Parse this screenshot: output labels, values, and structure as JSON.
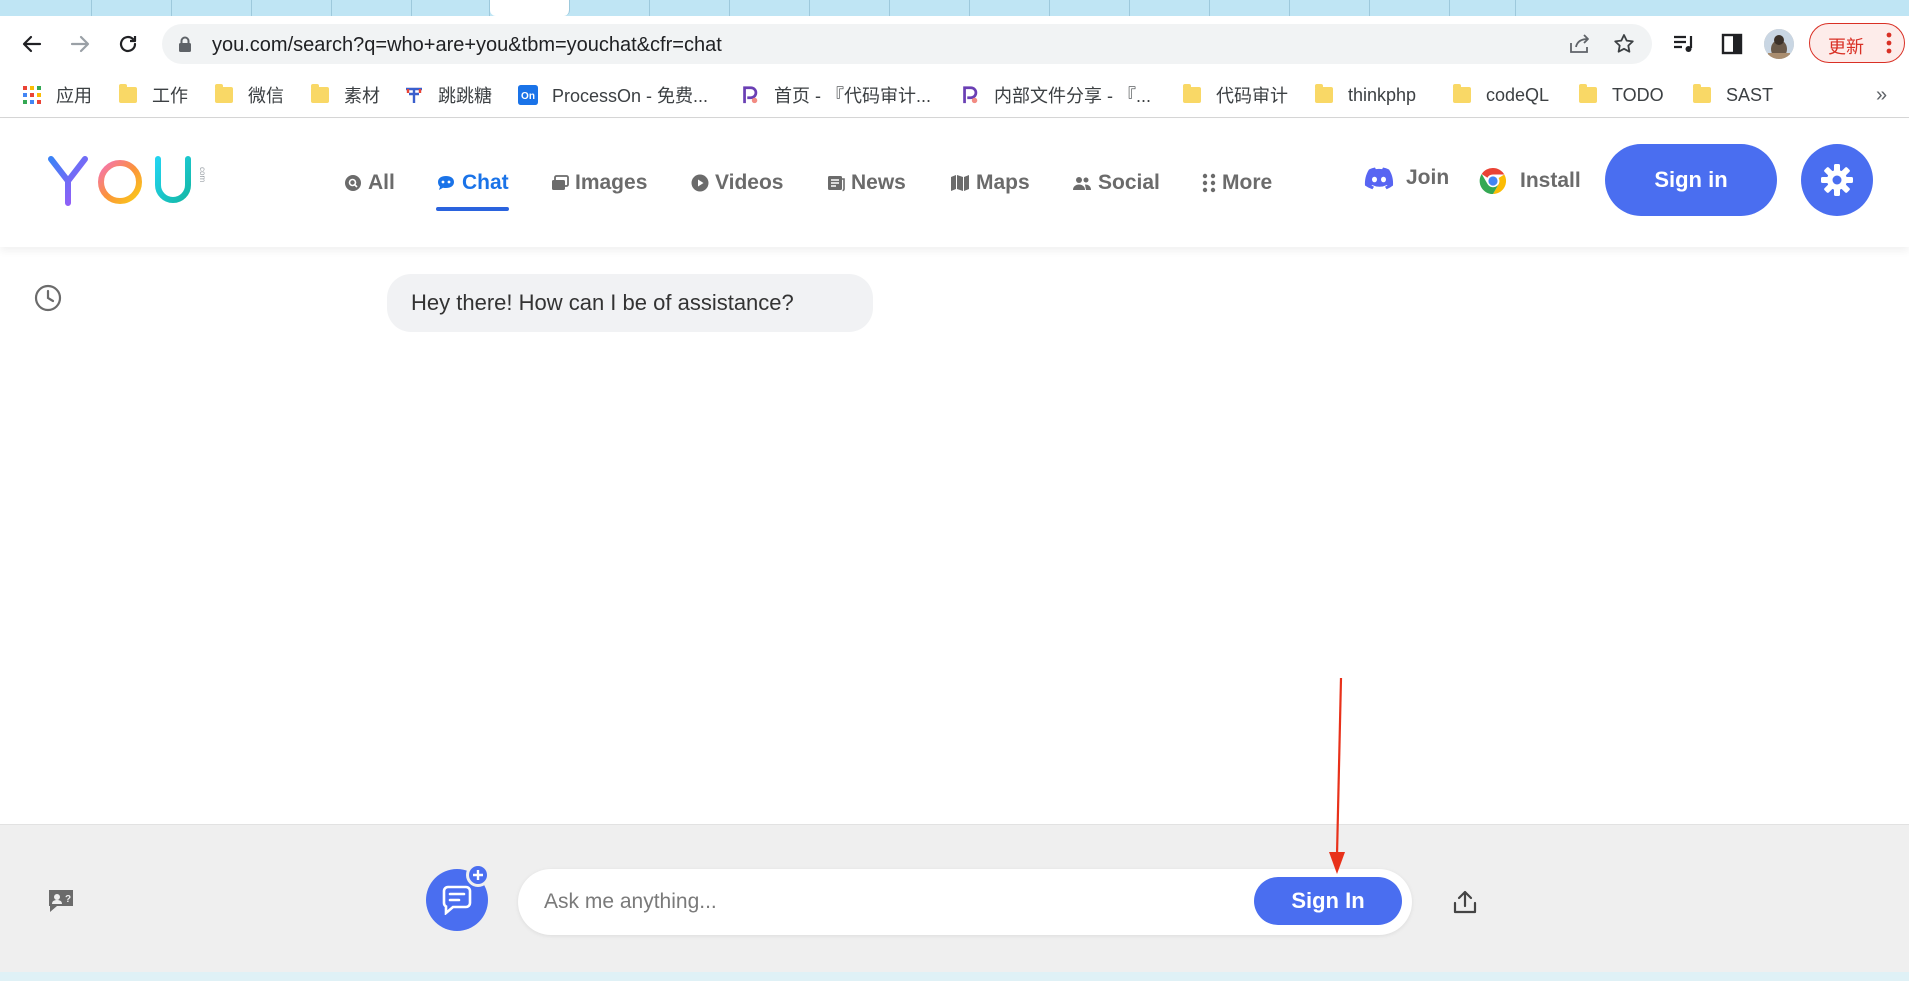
{
  "browser": {
    "url": "you.com/search?q=who+are+you&tbm=youchat&cfr=chat",
    "update_label": "更新",
    "bookmarks": [
      {
        "label": "应用",
        "icon": "apps-grid-icon"
      },
      {
        "label": "工作",
        "icon": "folder-icon"
      },
      {
        "label": "微信",
        "icon": "folder-icon"
      },
      {
        "label": "素材",
        "icon": "folder-icon"
      },
      {
        "label": "跳跳糖",
        "icon": "tiaotiaotang-icon"
      },
      {
        "label": "ProcessOn - 免费...",
        "icon": "processon-icon"
      },
      {
        "label": "首页 - 『代码审计...",
        "icon": "p-logo-icon"
      },
      {
        "label": "内部文件分享 - 『...",
        "icon": "p-logo-icon"
      },
      {
        "label": "代码审计",
        "icon": "folder-icon"
      },
      {
        "label": "thinkphp",
        "icon": "folder-icon"
      },
      {
        "label": "codeQL",
        "icon": "folder-icon"
      },
      {
        "label": "TODO",
        "icon": "folder-icon"
      },
      {
        "label": "SAST",
        "icon": "folder-icon"
      }
    ],
    "bookmarks_more": "»"
  },
  "site": {
    "nav": [
      {
        "label": "All",
        "icon": "search-icon"
      },
      {
        "label": "Chat",
        "icon": "chat-icon"
      },
      {
        "label": "Images",
        "icon": "images-icon"
      },
      {
        "label": "Videos",
        "icon": "play-icon"
      },
      {
        "label": "News",
        "icon": "news-icon"
      },
      {
        "label": "Maps",
        "icon": "map-icon"
      },
      {
        "label": "Social",
        "icon": "people-icon"
      },
      {
        "label": "More",
        "icon": "dots-grid-icon"
      }
    ],
    "active_tab": "Chat",
    "join_label": "Join",
    "install_label": "Install",
    "signin_label": "Sign in",
    "accent": "#4a6ef0"
  },
  "chat": {
    "greeting": "Hey there! How can I be of assistance?",
    "input_placeholder": "Ask me anything...",
    "signin_label": "Sign In"
  }
}
